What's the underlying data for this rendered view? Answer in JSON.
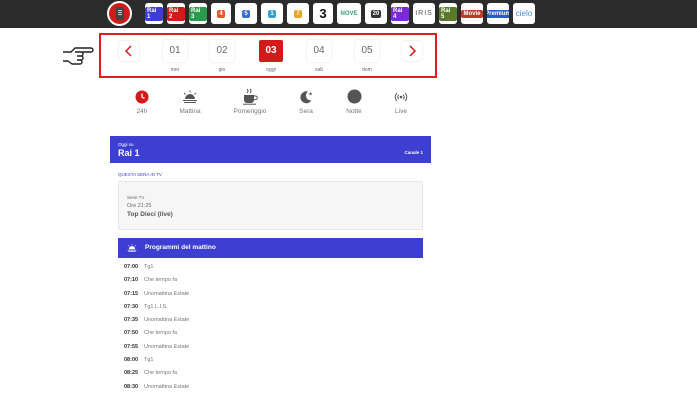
{
  "channels": [
    {
      "id": "rai1",
      "text": "Rai 1",
      "color": "#3d3fd1",
      "w": 18
    },
    {
      "id": "rai2",
      "text": "Rai 2",
      "color": "#d21a1a",
      "w": 18
    },
    {
      "id": "rai3",
      "text": "Rai 3",
      "color": "#2a9a4b",
      "w": 18
    },
    {
      "id": "rete4",
      "text": "4",
      "color": "#e85a2a",
      "w": 20
    },
    {
      "id": "canale5",
      "text": "5",
      "color": "#3b6fc9",
      "w": 22
    },
    {
      "id": "italia1",
      "text": "1",
      "color": "#3aa0c9",
      "w": 22
    },
    {
      "id": "la7",
      "text": "7",
      "color": "#e8a72a",
      "w": 22
    },
    {
      "id": "tv8",
      "text": "3",
      "color": "#111111",
      "w": 20
    },
    {
      "id": "nove",
      "text": "NOVE",
      "color": "#3aa07a",
      "w": 24
    },
    {
      "id": "twentymediaset",
      "text": "20",
      "color": "#333333",
      "w": 22
    },
    {
      "id": "rai4",
      "text": "Rai 4",
      "color": "#7a2ad2",
      "w": 18
    },
    {
      "id": "iris",
      "text": "IRIS",
      "color": "#555555",
      "w": 22
    },
    {
      "id": "rai5",
      "text": "Rai 5",
      "color": "#5a7a2a",
      "w": 18
    },
    {
      "id": "raimovie",
      "text": "Movie",
      "color": "#c0392b",
      "w": 22
    },
    {
      "id": "raipremium",
      "text": "Premium",
      "color": "#2a5ad2",
      "w": 22
    },
    {
      "id": "cielo",
      "text": "cielo",
      "color": "#4a8fd6",
      "w": 22
    }
  ],
  "dates": {
    "prev_icon": "chevron-left-icon",
    "next_icon": "chevron-right-icon",
    "days": [
      {
        "num": "01",
        "label": "mer"
      },
      {
        "num": "02",
        "label": "gio"
      },
      {
        "num": "03",
        "label": "oggi",
        "active": true
      },
      {
        "num": "04",
        "label": "sab"
      },
      {
        "num": "05",
        "label": "dom"
      }
    ]
  },
  "filters": [
    {
      "label": "24h",
      "icon": "clock-icon"
    },
    {
      "label": "Mattina",
      "icon": "sunrise-icon"
    },
    {
      "label": "Pomeriggio",
      "icon": "coffee-icon"
    },
    {
      "label": "Sera",
      "icon": "moon-icon"
    },
    {
      "label": "Notte",
      "icon": "night-icon"
    },
    {
      "label": "Live",
      "icon": "broadcast-icon"
    }
  ],
  "channel_header": {
    "kicker": "Oggi su",
    "name": "Rai 1",
    "number": "Canale 1"
  },
  "tonight": {
    "label": "QUESTA SERA IN TV",
    "genre": "Serie TV",
    "time": "Ore 21:25",
    "title": "Top Dieci (live)"
  },
  "section": {
    "title": "Programmi del mattino",
    "icon": "sunrise-icon"
  },
  "programs": [
    {
      "time": "07:00",
      "name": "Tg1"
    },
    {
      "time": "07:10",
      "name": "Che tempo fa"
    },
    {
      "time": "07:15",
      "name": "Unomattina Estate"
    },
    {
      "time": "07:30",
      "name": "Tg1 L.I.S."
    },
    {
      "time": "07:35",
      "name": "Unomattina Estate"
    },
    {
      "time": "07:50",
      "name": "Che tempo fa"
    },
    {
      "time": "07:55",
      "name": "Unomattina Estate"
    },
    {
      "time": "08:00",
      "name": "Tg1"
    },
    {
      "time": "08:25",
      "name": "Che tempo fa"
    },
    {
      "time": "08:30",
      "name": "Unomattina Estate"
    }
  ],
  "colors": {
    "accent_red": "#d21a1a",
    "brand_blue": "#3d3fd1",
    "highlight_border": "#e21c24"
  }
}
